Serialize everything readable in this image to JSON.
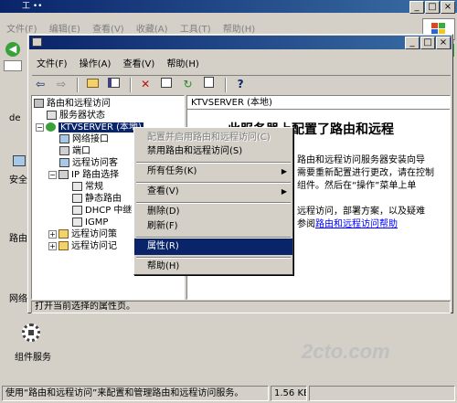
{
  "outer_window": {
    "title": "工 ••",
    "menu": [
      "文件(F)",
      "编辑(E)",
      "查看(V)",
      "收藏(A)",
      "工具(T)",
      "帮助(H)"
    ],
    "left_labels": [
      "de",
      "安全",
      "路由",
      "网络"
    ],
    "desktop_icon_label": "组件服务",
    "status_text": "使用“路由和远程访问”来配置和管理路由和远程访问服务。",
    "status_size": "1.56 KB"
  },
  "mmc": {
    "menu": [
      "文件(F)",
      "操作(A)",
      "查看(V)",
      "帮助(H)"
    ],
    "tree": [
      {
        "label": "路由和远程访问"
      },
      {
        "label": "服务器状态"
      },
      {
        "label": "KTVSERVER (本地)"
      },
      {
        "label": "网络接口"
      },
      {
        "label": "端口"
      },
      {
        "label": "远程访问客"
      },
      {
        "label": "IP 路由选择"
      },
      {
        "label": "常规"
      },
      {
        "label": "静态路由"
      },
      {
        "label": "DHCP 中继"
      },
      {
        "label": "IGMP"
      },
      {
        "label": "远程访问策"
      },
      {
        "label": "远程访问记"
      }
    ],
    "right_header": "KTVSERVER (本地)",
    "right_title": "此服务器上配置了路由和远程",
    "right_lines": [
      "路由和远程访问服务器安装向导",
      "需要重新配置进行更改，请在控制",
      "组件。然后在“操作”菜单上单",
      "",
      "远程访问，部署方案，以及疑难"
    ],
    "right_link_prefix": "参阅",
    "right_link": "路由和远程访问帮助",
    "status_text": "打开当前选择的属性页。"
  },
  "context_menu": {
    "items": [
      {
        "label": "配置并启用路由和远程访问(C)",
        "disabled": true
      },
      {
        "label": "禁用路由和远程访问(S)"
      },
      {
        "label": "所有任务(K)",
        "submenu": true
      },
      {
        "label": "查看(V)",
        "submenu": true
      },
      {
        "label": "删除(D)"
      },
      {
        "label": "刷新(F)"
      },
      {
        "label": "属性(R)",
        "selected": true
      },
      {
        "label": "帮助(H)"
      }
    ]
  },
  "watermark": "2cto.com",
  "colors": {
    "titlebar": "#0a246a",
    "selection": "#0a246a",
    "link": "#0000ff"
  }
}
